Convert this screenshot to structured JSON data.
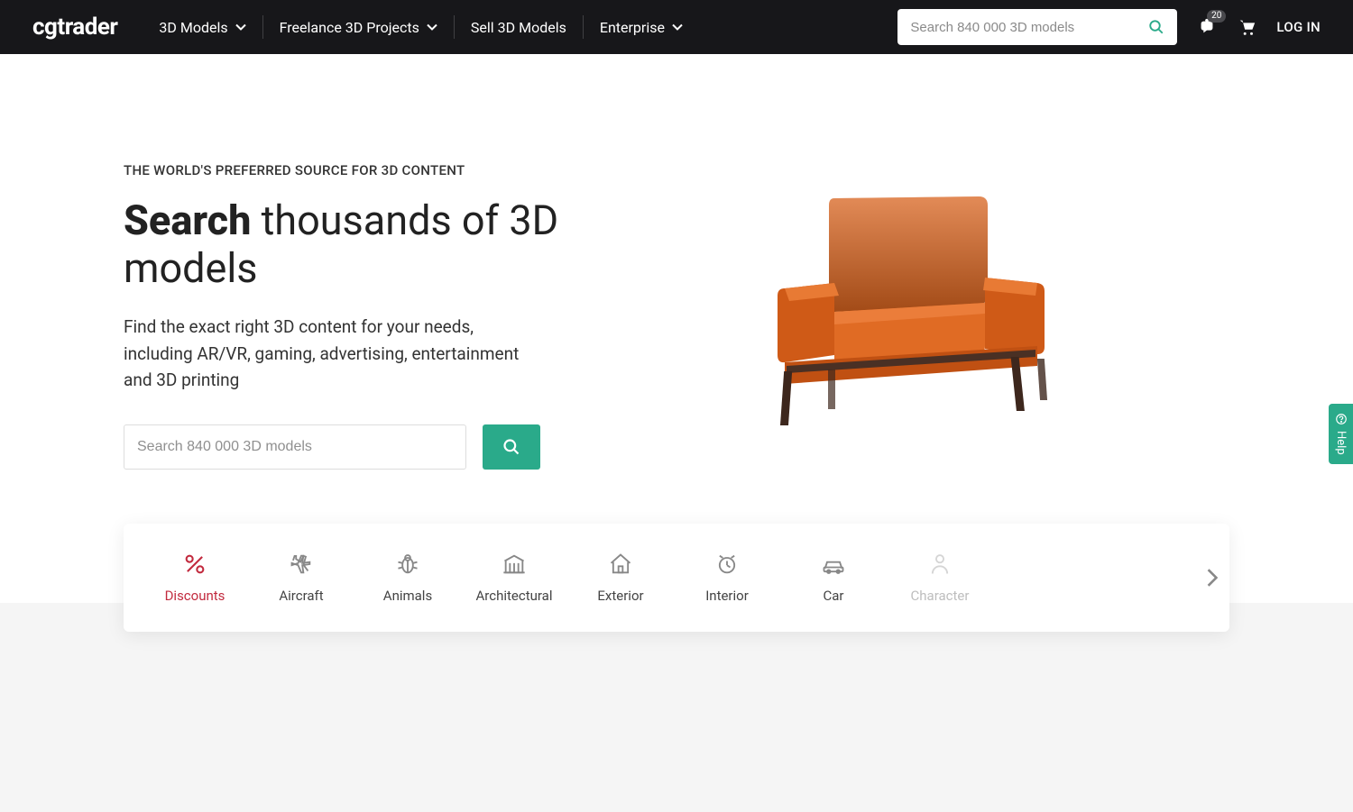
{
  "header": {
    "logo": "cgtrader",
    "nav": [
      {
        "label": "3D Models",
        "dropdown": true
      },
      {
        "label": "Freelance 3D Projects",
        "dropdown": true
      },
      {
        "label": "Sell 3D Models",
        "dropdown": false
      },
      {
        "label": "Enterprise",
        "dropdown": true
      }
    ],
    "search_placeholder": "Search 840 000 3D models",
    "notification_count": "20",
    "login": "LOG IN"
  },
  "hero": {
    "eyebrow": "THE WORLD'S PREFERRED SOURCE FOR 3D CONTENT",
    "title_bold": "Search",
    "title_rest": " thousands of 3D models",
    "subtitle": "Find the exact right 3D content for your needs, including AR/VR, gaming, advertising, entertainment and 3D printing",
    "search_placeholder": "Search 840 000 3D models"
  },
  "categories": [
    {
      "label": "Discounts",
      "icon": "percent",
      "active": true
    },
    {
      "label": "Aircraft",
      "icon": "plane",
      "active": false
    },
    {
      "label": "Animals",
      "icon": "bug",
      "active": false
    },
    {
      "label": "Architectural",
      "icon": "building",
      "active": false
    },
    {
      "label": "Exterior",
      "icon": "house",
      "active": false
    },
    {
      "label": "Interior",
      "icon": "clock",
      "active": false
    },
    {
      "label": "Car",
      "icon": "car",
      "active": false
    },
    {
      "label": "Character",
      "icon": "person",
      "active": false
    }
  ],
  "help": {
    "label": "Help"
  },
  "colors": {
    "accent": "#2aaa8a",
    "discount": "#c22a3e"
  }
}
